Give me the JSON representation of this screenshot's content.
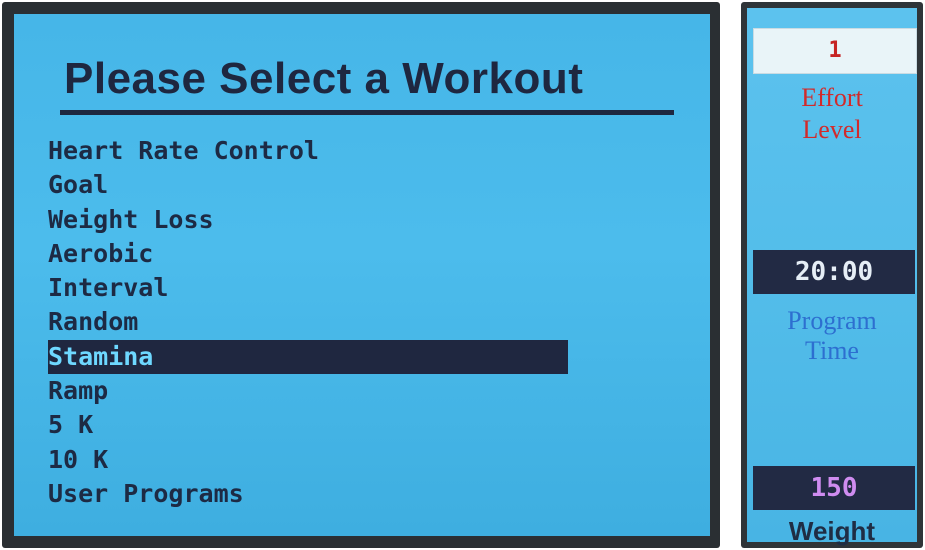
{
  "main": {
    "title": "Please Select a Workout",
    "menu": [
      "Heart Rate Control",
      "Goal",
      "Weight Loss",
      "Aerobic",
      "Interval",
      "Random",
      "Stamina",
      "Ramp",
      "5 K",
      "10 K",
      "User Programs"
    ],
    "selected_item": "Stamina"
  },
  "side": {
    "effort_value": "1",
    "effort_label_line1": "Effort",
    "effort_label_line2": "Level",
    "time_value": "20:00",
    "time_label_line1": "Program",
    "time_label_line2": "Time",
    "weight_value": "150",
    "weight_label": "Weight"
  },
  "colors": {
    "screen_bg": "#46b6e8",
    "text_dark": "#1e2740",
    "highlight_bg": "#1f2740",
    "effort_red": "#d22a2a",
    "program_blue": "#2d6fd0",
    "weight_purple": "#cf8cf0"
  }
}
